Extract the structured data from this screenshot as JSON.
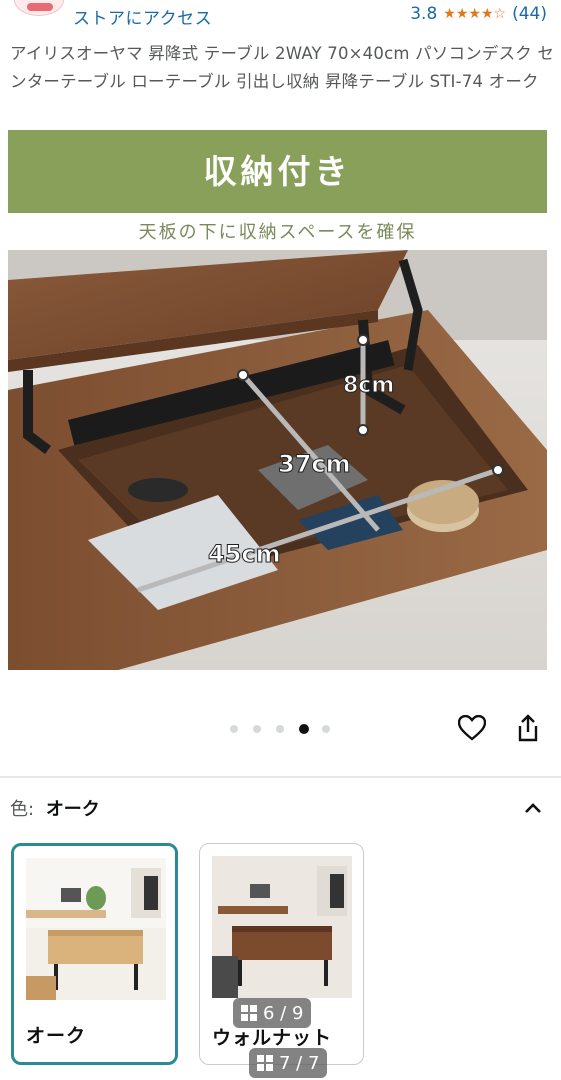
{
  "store": {
    "link": "ストアにアクセス",
    "rating": "3.8",
    "review_count": "(44)",
    "stars_filled": 3.8
  },
  "product": {
    "title": "アイリスオーヤマ 昇降式 テーブル 2WAY 70×40cm パソコンデスク センターテーブル ローテーブル 引出し収納 昇降テーブル STI-74 オーク"
  },
  "hero": {
    "banner": "収納付き",
    "caption": "天板の下に収納スペースを確保",
    "dim_height": "8cm",
    "dim_depth": "37cm",
    "dim_width": "45cm"
  },
  "carousel": {
    "total": 5,
    "active_index": 3
  },
  "actions": {
    "favorite_icon": "heart-icon",
    "share_icon": "share-icon"
  },
  "color": {
    "label": "色:",
    "value": "オーク",
    "options": [
      {
        "name": "オーク",
        "selected": true,
        "counter": "6 / 9"
      },
      {
        "name": "ウォルナット",
        "selected": false,
        "counter": "7 / 7"
      }
    ]
  },
  "colors": {
    "accent": "#2a8a96",
    "banner": "#88a05a",
    "link": "#1a6aa8",
    "star": "#de7921"
  }
}
